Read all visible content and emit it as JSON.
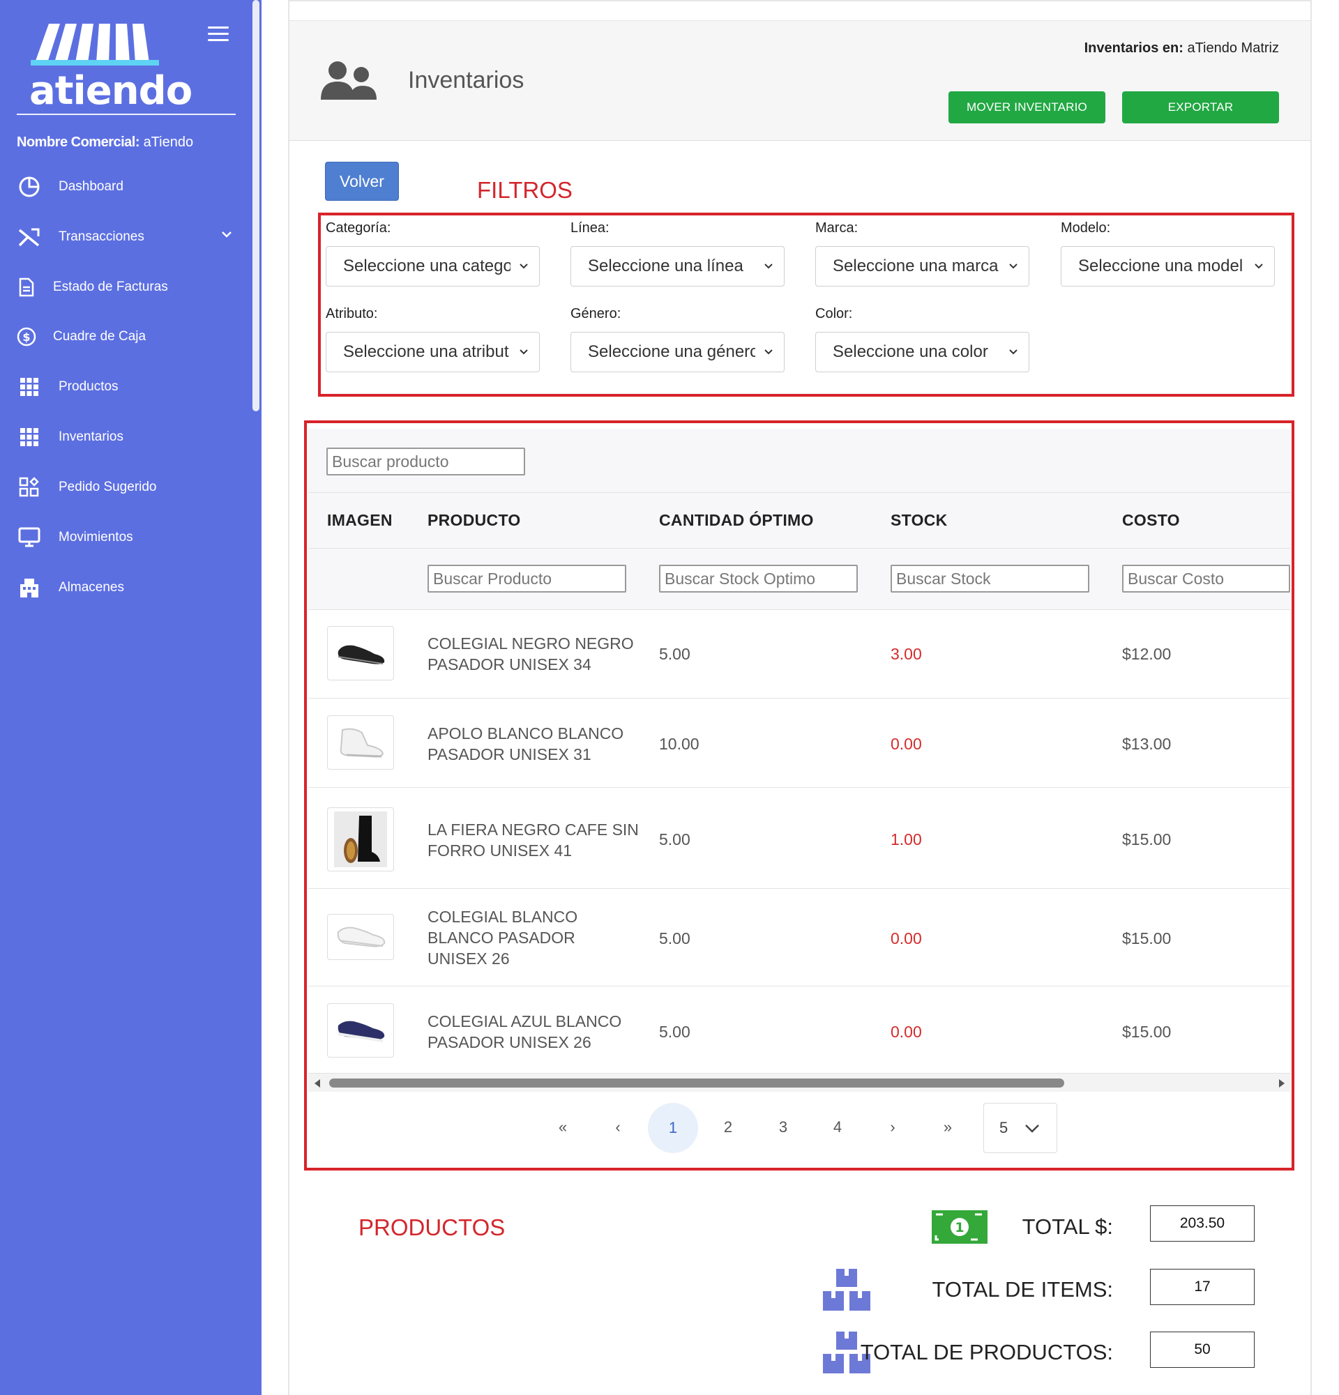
{
  "sidebar": {
    "logo_text": "atiendo",
    "commercial_label": "Nombre Comercial:",
    "commercial_value": "aTiendo",
    "items": [
      {
        "label": "Dashboard",
        "icon": "pie-chart-icon"
      },
      {
        "label": "Transacciones",
        "icon": "tools-icon",
        "has_submenu": true
      },
      {
        "label": "Estado de Facturas",
        "icon": "document-icon"
      },
      {
        "label": "Cuadre de Caja",
        "icon": "dollar-circle-icon"
      },
      {
        "label": "Productos",
        "icon": "grid-icon"
      },
      {
        "label": "Inventarios",
        "icon": "grid-icon"
      },
      {
        "label": "Pedido Sugerido",
        "icon": "apps-add-icon"
      },
      {
        "label": "Movimientos",
        "icon": "monitor-icon"
      },
      {
        "label": "Almacenes",
        "icon": "building-icon"
      }
    ]
  },
  "header": {
    "title": "Inventarios",
    "location_label": "Inventarios en:",
    "location_value": "aTiendo Matriz",
    "move_button": "MOVER INVENTARIO",
    "export_button": "EXPORTAR",
    "back_button": "Volver"
  },
  "annotations": {
    "filters": "FILTROS",
    "products": "PRODUCTOS"
  },
  "filters": [
    {
      "label": "Categoría:",
      "value": "Seleccione una catego"
    },
    {
      "label": "Línea:",
      "value": "Seleccione una línea"
    },
    {
      "label": "Marca:",
      "value": "Seleccione una marca"
    },
    {
      "label": "Modelo:",
      "value": "Seleccione una model"
    },
    {
      "label": "Atributo:",
      "value": "Seleccione una atribut"
    },
    {
      "label": "Género:",
      "value": "Seleccione una génerc"
    },
    {
      "label": "Color:",
      "value": "Seleccione una color"
    }
  ],
  "table": {
    "search_placeholder": "Buscar producto",
    "columns": [
      "IMAGEN",
      "PRODUCTO",
      "CANTIDAD ÓPTIMO",
      "STOCK",
      "COSTO"
    ],
    "column_filters": [
      "Buscar Producto",
      "Buscar Stock Optimo",
      "Buscar Stock",
      "Buscar Costo"
    ],
    "rows": [
      {
        "image": "black-shoe",
        "product_lines": [
          "COLEGIAL NEGRO NEGRO",
          "PASADOR UNISEX 34"
        ],
        "optimo": "5.00",
        "stock": "3.00",
        "costo": "$12.00"
      },
      {
        "image": "white-high-sneaker",
        "product_lines": [
          "APOLO BLANCO BLANCO",
          "PASADOR UNISEX 31"
        ],
        "optimo": "10.00",
        "stock": "0.00",
        "costo": "$13.00"
      },
      {
        "image": "black-boot",
        "product_lines": [
          "LA FIERA NEGRO CAFE SIN",
          "FORRO UNISEX 41"
        ],
        "optimo": "5.00",
        "stock": "1.00",
        "costo": "$15.00"
      },
      {
        "image": "white-shoe",
        "product_lines": [
          "COLEGIAL BLANCO",
          "BLANCO PASADOR",
          "UNISEX 26"
        ],
        "optimo": "5.00",
        "stock": "0.00",
        "costo": "$15.00"
      },
      {
        "image": "navy-sneaker",
        "product_lines": [
          "COLEGIAL AZUL BLANCO",
          "PASADOR UNISEX 26"
        ],
        "optimo": "5.00",
        "stock": "0.00",
        "costo": "$15.00"
      }
    ]
  },
  "pagination": {
    "first": "«",
    "prev": "‹",
    "pages": [
      "1",
      "2",
      "3",
      "4"
    ],
    "active_page": "1",
    "next": "›",
    "last": "»",
    "page_size": "5"
  },
  "totals": {
    "total_money_label": "TOTAL $:",
    "total_money_value": "203.50",
    "total_items_label": "TOTAL DE ITEMS:",
    "total_items_value": "17",
    "total_products_label": "TOTAL DE PRODUCTOS:",
    "total_products_value": "50"
  },
  "colors": {
    "sidebar": "#5c6fe1",
    "green_button": "#22a843",
    "annotation_red": "#d8232a",
    "back_button": "#4f7fd0",
    "stock_red": "#d62b2b"
  }
}
